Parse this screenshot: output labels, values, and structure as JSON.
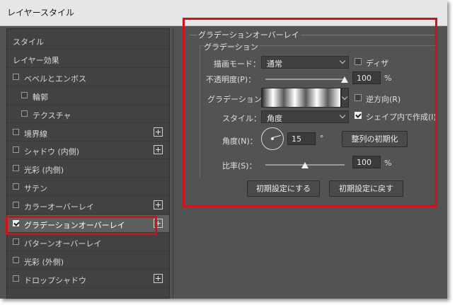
{
  "window": {
    "title": "レイヤースタイル"
  },
  "sidebar": {
    "items": [
      {
        "label": "スタイル",
        "checkbox": false,
        "plus": false,
        "checked": false,
        "indent": false,
        "selected": false
      },
      {
        "label": "レイヤー効果",
        "checkbox": false,
        "plus": false,
        "checked": false,
        "indent": false,
        "selected": false
      },
      {
        "label": "ベベルとエンボス",
        "checkbox": true,
        "plus": false,
        "checked": false,
        "indent": false,
        "selected": false
      },
      {
        "label": "輪郭",
        "checkbox": true,
        "plus": false,
        "checked": false,
        "indent": true,
        "selected": false
      },
      {
        "label": "テクスチャ",
        "checkbox": true,
        "plus": false,
        "checked": false,
        "indent": true,
        "selected": false
      },
      {
        "label": "境界線",
        "checkbox": true,
        "plus": true,
        "checked": false,
        "indent": false,
        "selected": false
      },
      {
        "label": "シャドウ (内側)",
        "checkbox": true,
        "plus": true,
        "checked": false,
        "indent": false,
        "selected": false
      },
      {
        "label": "光彩 (内側)",
        "checkbox": true,
        "plus": false,
        "checked": false,
        "indent": false,
        "selected": false
      },
      {
        "label": "サテン",
        "checkbox": true,
        "plus": false,
        "checked": false,
        "indent": false,
        "selected": false
      },
      {
        "label": "カラーオーバーレイ",
        "checkbox": true,
        "plus": true,
        "checked": false,
        "indent": false,
        "selected": false
      },
      {
        "label": "グラデーションオーバーレイ",
        "checkbox": true,
        "plus": true,
        "checked": true,
        "indent": false,
        "selected": true
      },
      {
        "label": "パターンオーバーレイ",
        "checkbox": true,
        "plus": false,
        "checked": false,
        "indent": false,
        "selected": false
      },
      {
        "label": "光彩 (外側)",
        "checkbox": true,
        "plus": false,
        "checked": false,
        "indent": false,
        "selected": false
      },
      {
        "label": "ドロップシャドウ",
        "checkbox": true,
        "plus": true,
        "checked": false,
        "indent": false,
        "selected": false
      }
    ]
  },
  "panel": {
    "group_title": "グラデーションオーバーレイ",
    "subgroup_title": "グラデーション",
    "blend_mode": {
      "label": "描画モード：",
      "value": "通常"
    },
    "dither": {
      "label": "ディザ",
      "checked": false
    },
    "opacity": {
      "label": "不透明度(P)：",
      "value": "100",
      "unit": "%",
      "fraction": 1.0
    },
    "gradient": {
      "label": "グラデーション："
    },
    "reverse": {
      "label": "逆方向(R)",
      "checked": false
    },
    "style": {
      "label": "スタイル：",
      "value": "角度"
    },
    "align_with_layer": {
      "label": "シェイプ内で作成(I)",
      "checked": true
    },
    "angle": {
      "label": "角度(N)：",
      "value": "15",
      "unit": "°"
    },
    "reset_alignment": {
      "label": "整列の初期化"
    },
    "scale": {
      "label": "比率(S)：",
      "value": "100",
      "unit": "%",
      "fraction": 0.5
    },
    "make_default": {
      "label": "初期設定にする"
    },
    "reset_default": {
      "label": "初期設定に戻す"
    }
  }
}
